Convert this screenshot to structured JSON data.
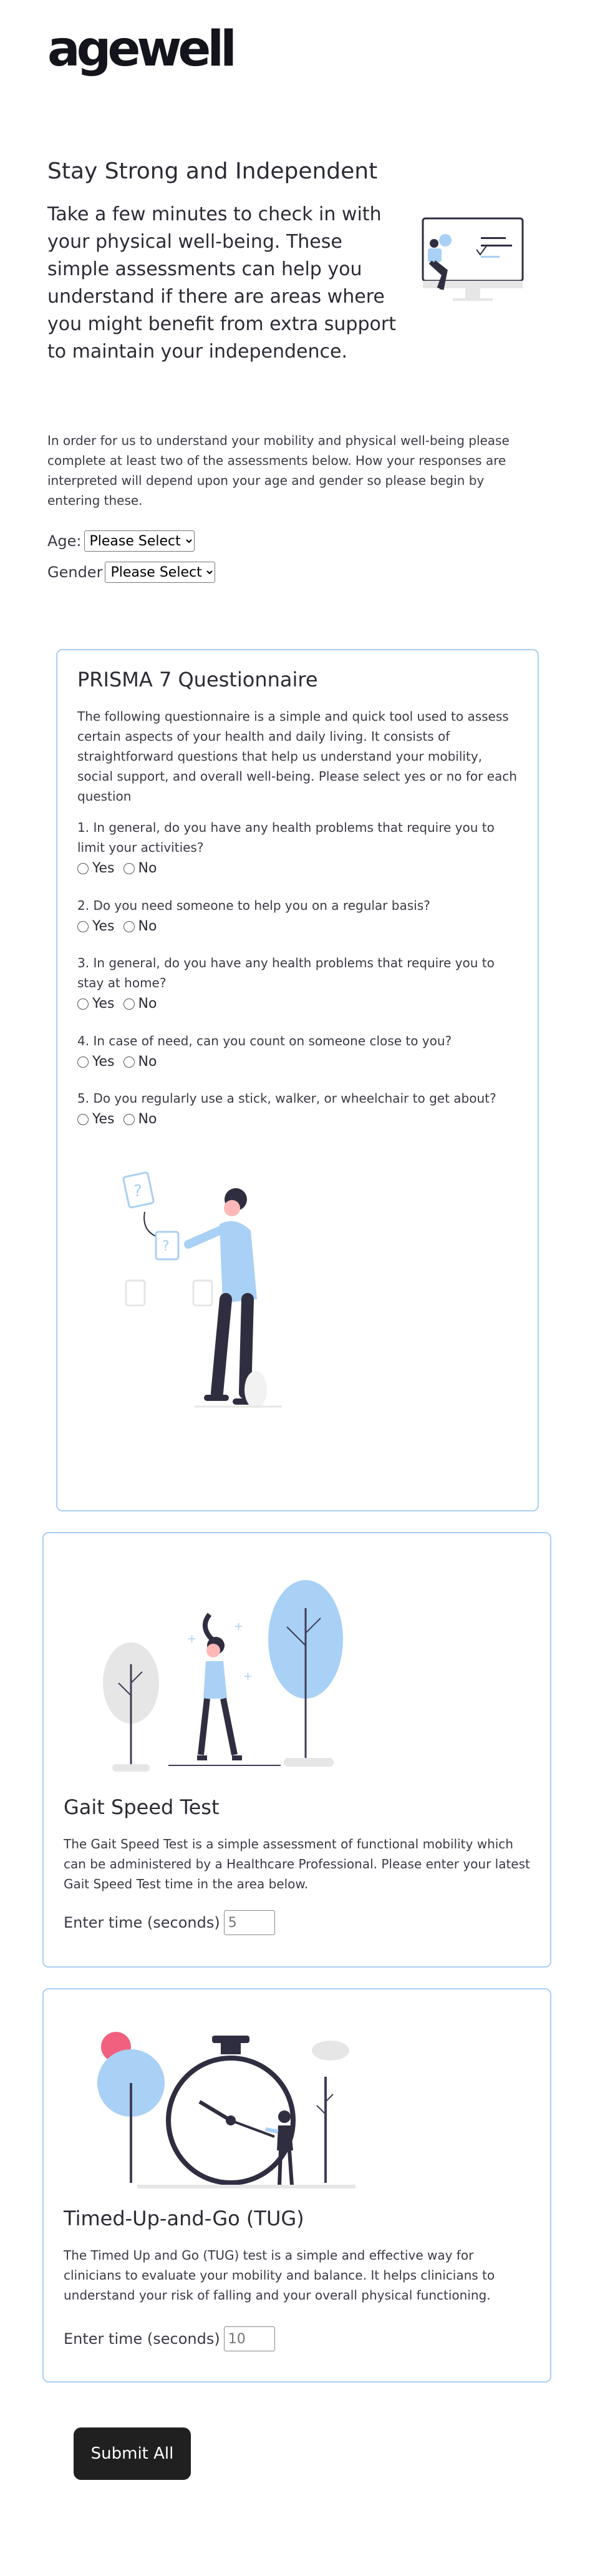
{
  "brand": {
    "logo_text": "agewell"
  },
  "hero": {
    "title": "Stay Strong and Independent",
    "text": "Take a few minutes to check in with your physical well-being. These simple assessments can help you understand if there are areas where you might benefit from extra support to maintain your independence."
  },
  "intro": "In order for us to understand your mobility and physical well-being please complete at least two of the assessments below. How your responses are interpreted will depend upon your age and gender so please begin by entering these.",
  "demographics": {
    "age_label": "Age:",
    "age_value": "Please Select",
    "gender_label": "Gender",
    "gender_value": "Please Select"
  },
  "prisma": {
    "title": "PRISMA 7 Questionnaire",
    "description": "The following questionnaire is a simple and quick tool used to assess certain aspects of your health and daily living. It consists of straightforward questions that help us understand your mobility, social support, and overall well-being. Please select yes or no for each question",
    "yes_label": "Yes",
    "no_label": "No",
    "questions": [
      "1. In general, do you have any health problems that require you to limit your activities?",
      "2. Do you need someone to help you on a regular basis?",
      "3. In general, do you have any health problems that require you to stay at home?",
      "4. In case of need, can you count on someone close to you?",
      "5. Do you regularly use a stick, walker, or wheelchair to get about?"
    ]
  },
  "gait": {
    "title": "Gait Speed Test",
    "description": "The Gait Speed Test is a simple assessment of functional mobility which can be administered by a Healthcare Professional. Please enter your latest Gait Speed Test time in the area below.",
    "time_label": "Enter time (seconds)",
    "time_placeholder": "5"
  },
  "tug": {
    "title": "Timed-Up-and-Go (TUG)",
    "description": "The Timed Up and Go (TUG) test is a simple and effective way for clinicians to evaluate your mobility and balance. It helps clinicians to understand your risk of falling and your overall physical functioning.",
    "time_label": "Enter time (seconds)",
    "time_placeholder": "10"
  },
  "submit_label": "Submit All",
  "colors": {
    "accent_light_blue": "#a9d0f5",
    "dark": "#2f2e41",
    "button": "#202020"
  }
}
